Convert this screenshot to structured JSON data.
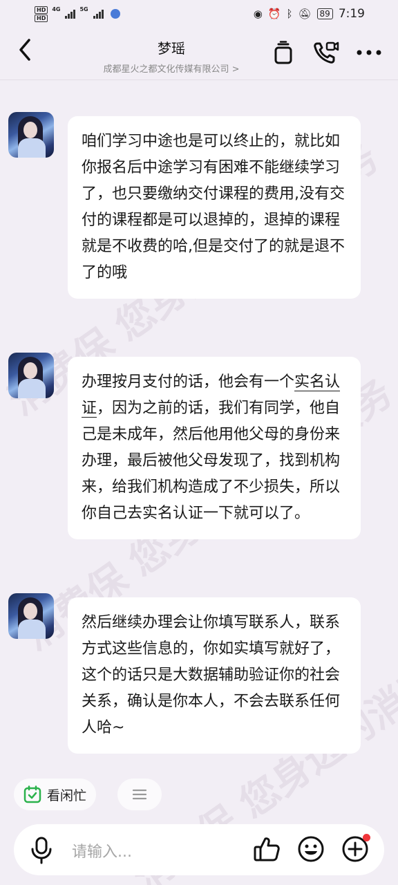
{
  "status_bar": {
    "hd1": "HD",
    "hd2": "HD",
    "net1": "4G",
    "net2": "5G",
    "battery": "89",
    "time": "7:19"
  },
  "header": {
    "title": "梦瑶",
    "subtitle": "成都星火之都文化传媒有限公司 >"
  },
  "watermark": {
    "lines": [
      "消费保 您身边的消费服务",
      "消费保 您身边的消费服务",
      "消费保 您身边的消费服务"
    ]
  },
  "messages": [
    {
      "text": "咱们学习中途也是可以终止的，就比如你报名后中途学习有困难不能继续学习了，也只要缴纳交付课程的费用,没有交付的课程都是可以退掉的，退掉的课程就是不收费的哈,但是交付了的就是退不了的哦"
    },
    {
      "text_before": "办理按月支付的话，他会有一个",
      "text_underlined": "实名认证",
      "text_after": "，因为之前的话，我们有同学，他自己是未成年，然后他用他父母的身份来办理，最后被他父母发现了，找到机构来，给我们机构造成了不少损失，所以你自己去实名认证一下就可以了。"
    },
    {
      "text": "然后继续办理会让你填写联系人，联系方式这些信息的，你如实填写就好了，这个的话只是大数据辅助验证你的社会关系，确认是你本人，不会去联系任何人哈~"
    }
  ],
  "quick_chips": {
    "chip1_label": "看闲忙",
    "chip2_icon": "menu-icon"
  },
  "input": {
    "placeholder": "请输入..."
  },
  "colors": {
    "background": "#f2eef5",
    "bubble": "#ffffff",
    "accent_green": "#2bb24c",
    "notify_red": "#f0353a"
  }
}
